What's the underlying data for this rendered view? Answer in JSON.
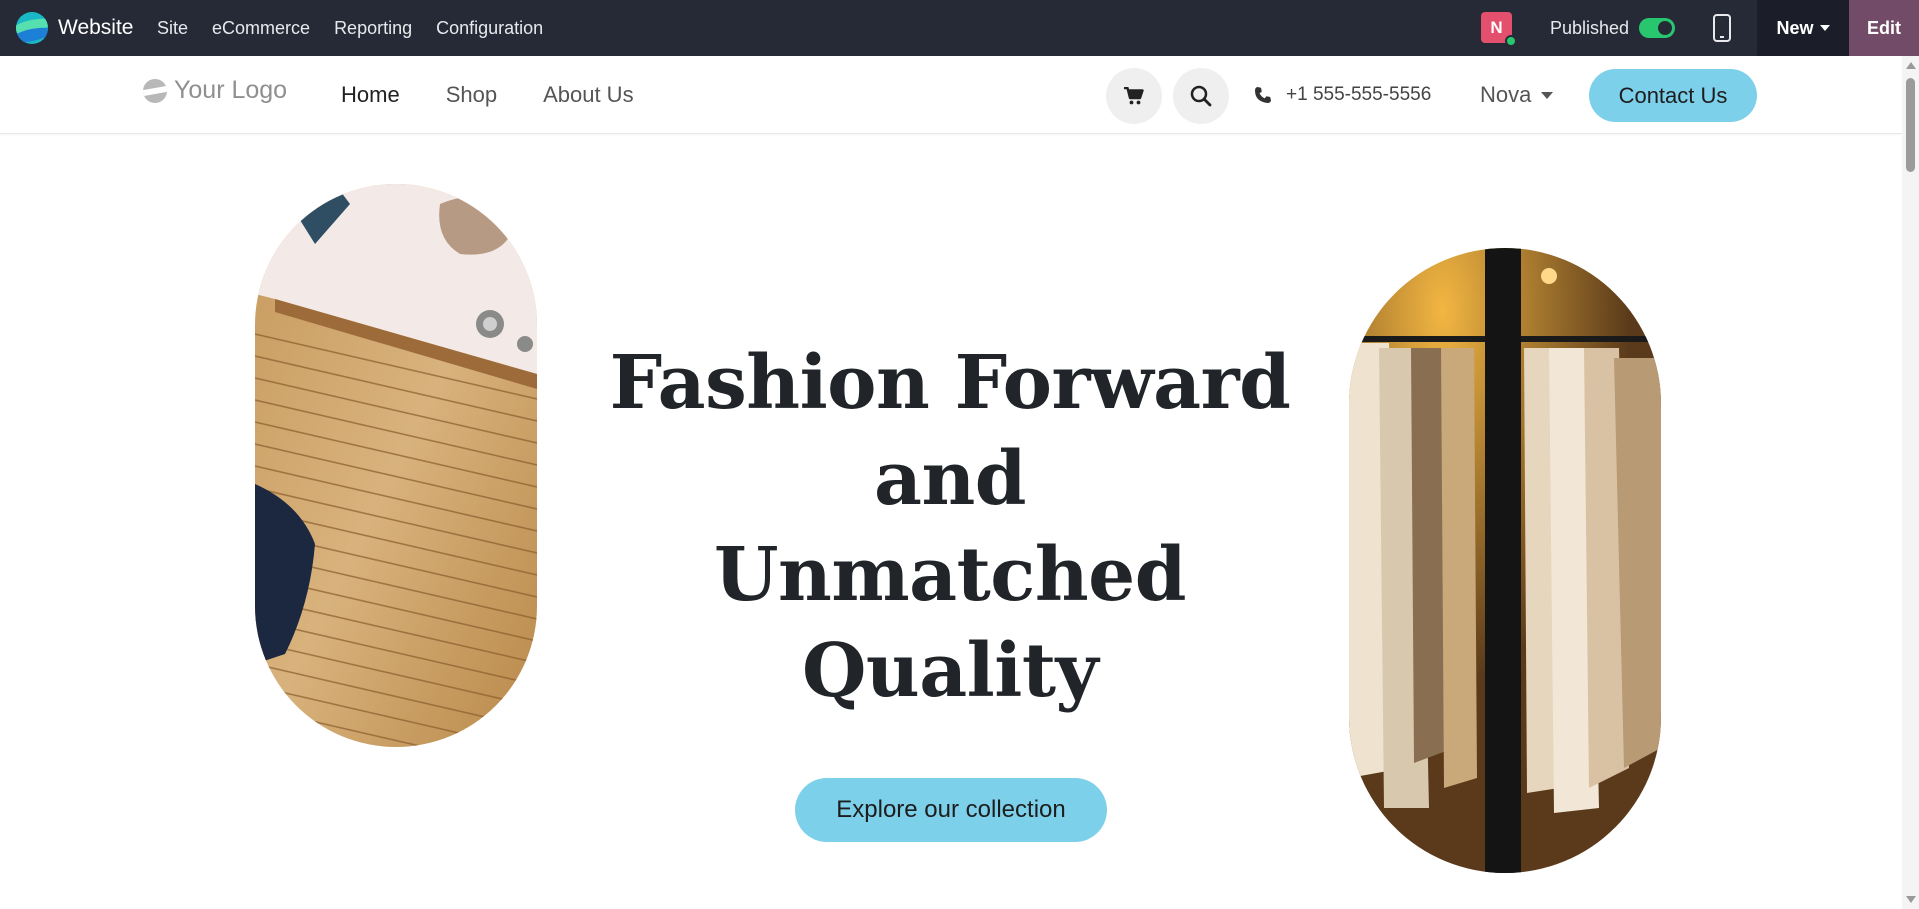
{
  "adminbar": {
    "app_name": "Website",
    "menu": [
      "Site",
      "eCommerce",
      "Reporting",
      "Configuration"
    ],
    "avatar_initial": "N",
    "published_label": "Published",
    "published": true,
    "new_label": "New",
    "edit_label": "Edit",
    "colors": {
      "bar": "#262a36",
      "edit": "#714b67",
      "toggle": "#28c76f"
    }
  },
  "header": {
    "logo_text": "Your Logo",
    "nav": [
      "Home",
      "Shop",
      "About Us"
    ],
    "active_nav": "Home",
    "phone": "+1 555-555-5556",
    "language": "Nova",
    "contact_label": "Contact Us",
    "icons": [
      "shopping-cart-icon",
      "search-icon",
      "phone-icon"
    ]
  },
  "hero": {
    "title_lines": [
      "Fashion Forward",
      "and",
      "Unmatched",
      "Quality"
    ],
    "cta_label": "Explore our collection",
    "accent_color": "#7dd0ea"
  }
}
